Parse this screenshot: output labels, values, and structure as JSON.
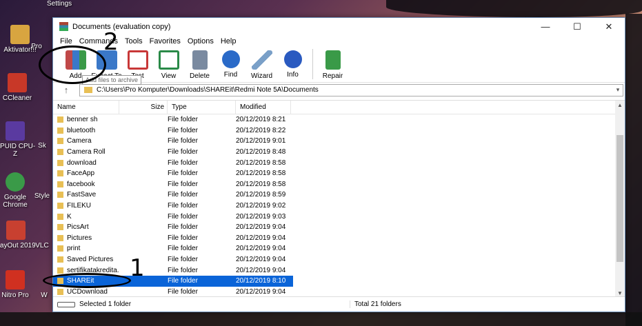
{
  "desktop": {
    "top_label": "Settings",
    "icons": [
      {
        "label": "Aktivator!!!",
        "color": "#d8a540"
      },
      {
        "label": "CCleaner",
        "color": "#c83828"
      },
      {
        "label": "CPUID CPU-Z",
        "color": "#5a3aa0"
      },
      {
        "label": "Google Chrome",
        "color": "#3a9a48"
      },
      {
        "label": "LayOut 2019",
        "color": "#c84030"
      },
      {
        "label": "Nitro Pro",
        "color": "#d03020"
      }
    ],
    "partial_labels": [
      "Pro",
      "Sk",
      "Style",
      "VLC",
      "W"
    ]
  },
  "window": {
    "title": "Documents (evaluation copy)",
    "controls": {
      "minimize": "—",
      "maximize": "☐",
      "close": "✕"
    },
    "menu": [
      "File",
      "Commands",
      "Tools",
      "Favorites",
      "Options",
      "Help"
    ],
    "toolbar": [
      {
        "label": "Add",
        "icon": "add-archive-icon",
        "color": "#c04848"
      },
      {
        "label": "Extract To",
        "icon": "extract-icon",
        "color": "#3a78c8"
      },
      {
        "label": "Test",
        "icon": "test-icon",
        "color": "#c83838"
      },
      {
        "label": "View",
        "icon": "view-icon",
        "color": "#2a8a48"
      },
      {
        "label": "Delete",
        "icon": "delete-icon",
        "color": "#7a8aa0"
      },
      {
        "label": "Find",
        "icon": "find-icon",
        "color": "#2a6ac8"
      },
      {
        "label": "Wizard",
        "icon": "wizard-icon",
        "color": "#7aa0c8"
      },
      {
        "label": "Info",
        "icon": "info-icon",
        "color": "#2a5ac0"
      },
      {
        "label": "Repair",
        "icon": "repair-icon",
        "color": "#3a9a48"
      }
    ],
    "tooltip": "Add files to archive",
    "path": "C:\\Users\\Pro Komputer\\Downloads\\SHAREit\\Redmi Note 5A\\Documents",
    "columns": [
      "Name",
      "Size",
      "Type",
      "Modified"
    ],
    "files": [
      {
        "name": "benner sh",
        "size": "",
        "type": "File folder",
        "modified": "20/12/2019 8:21"
      },
      {
        "name": "bluetooth",
        "size": "",
        "type": "File folder",
        "modified": "20/12/2019 8:22"
      },
      {
        "name": "Camera",
        "size": "",
        "type": "File folder",
        "modified": "20/12/2019 9:01"
      },
      {
        "name": "Camera Roll",
        "size": "",
        "type": "File folder",
        "modified": "20/12/2019 8:48"
      },
      {
        "name": "download",
        "size": "",
        "type": "File folder",
        "modified": "20/12/2019 8:58"
      },
      {
        "name": "FaceApp",
        "size": "",
        "type": "File folder",
        "modified": "20/12/2019 8:58"
      },
      {
        "name": "facebook",
        "size": "",
        "type": "File folder",
        "modified": "20/12/2019 8:58"
      },
      {
        "name": "FastSave",
        "size": "",
        "type": "File folder",
        "modified": "20/12/2019 8:59"
      },
      {
        "name": "FILEKU",
        "size": "",
        "type": "File folder",
        "modified": "20/12/2019 9:02"
      },
      {
        "name": "K",
        "size": "",
        "type": "File folder",
        "modified": "20/12/2019 9:03"
      },
      {
        "name": "PicsArt",
        "size": "",
        "type": "File folder",
        "modified": "20/12/2019 9:04"
      },
      {
        "name": "Pictures",
        "size": "",
        "type": "File folder",
        "modified": "20/12/2019 9:04"
      },
      {
        "name": "print",
        "size": "",
        "type": "File folder",
        "modified": "20/12/2019 9:04"
      },
      {
        "name": "Saved Pictures",
        "size": "",
        "type": "File folder",
        "modified": "20/12/2019 9:04"
      },
      {
        "name": "sertifikatakredita...",
        "size": "",
        "type": "File folder",
        "modified": "20/12/2019 9:04"
      },
      {
        "name": "SHAREit",
        "size": "",
        "type": "File folder",
        "modified": "20/12/2019 8:10",
        "selected": true
      },
      {
        "name": "UCDownload",
        "size": "",
        "type": "File folder",
        "modified": "20/12/2019 9:04"
      }
    ],
    "status_left": "Selected 1 folder",
    "status_right": "Total 21 folders"
  },
  "annotations": {
    "one": "1",
    "two": "2"
  },
  "colors": {
    "selection": "#0a64d8",
    "folder": "#e8bf55"
  }
}
